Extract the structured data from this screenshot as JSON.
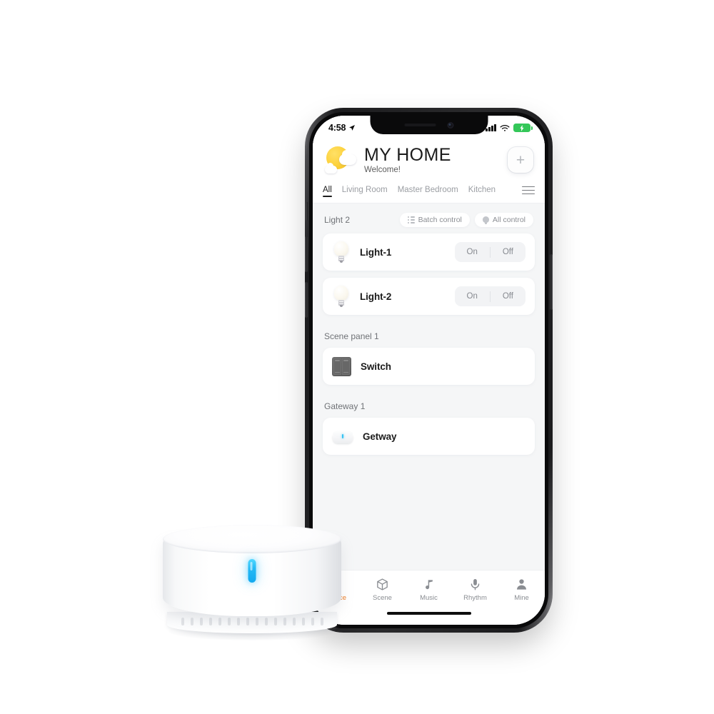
{
  "scene": {
    "background_color": "#ffffff",
    "product_name": "smart-home-hub",
    "product_led_color": "#23b9f5"
  },
  "phone": {
    "frame_color": "#1c1c1e",
    "screen_background": "#f5f6f7"
  },
  "status_bar": {
    "time": "4:58",
    "location_icon": "location-arrow-icon",
    "signal_icon": "cellular-signal-icon",
    "wifi_icon": "wifi-icon",
    "battery_icon": "battery-charging-icon",
    "battery_color": "#34c759"
  },
  "header": {
    "weather_icon": "sun-behind-cloud-icon",
    "title": "MY HOME",
    "subtitle": "Welcome!",
    "add_button_label": "+",
    "add_button_name": "add-device-button"
  },
  "room_tabs": {
    "items": [
      {
        "label": "All",
        "active": true
      },
      {
        "label": "Living Room",
        "active": false
      },
      {
        "label": "Master Bedroom",
        "active": false
      },
      {
        "label": "Kitchen",
        "active": false
      }
    ],
    "menu_icon": "hamburger-menu-icon"
  },
  "groups": [
    {
      "title": "Light 2",
      "actions": [
        {
          "label": "Batch control",
          "icon": "list-icon"
        },
        {
          "label": "All control",
          "icon": "bulb-icon"
        }
      ],
      "devices": [
        {
          "name": "Light-1",
          "icon": "light-bulb-icon",
          "controls": {
            "on": "On",
            "off": "Off"
          }
        },
        {
          "name": "Light-2",
          "icon": "light-bulb-icon",
          "controls": {
            "on": "On",
            "off": "Off"
          }
        }
      ]
    },
    {
      "title": "Scene panel 1",
      "actions": [],
      "devices": [
        {
          "name": "Switch",
          "icon": "wall-switch-icon"
        }
      ]
    },
    {
      "title": "Gateway 1",
      "actions": [],
      "devices": [
        {
          "name": "Getway",
          "icon": "gateway-hub-icon"
        }
      ]
    }
  ],
  "tab_bar": {
    "active_color": "#f07c22",
    "inactive_color": "#8a8d92",
    "items": [
      {
        "label": "Device",
        "icon": "bulb-icon",
        "active": true
      },
      {
        "label": "Scene",
        "icon": "cube-icon",
        "active": false
      },
      {
        "label": "Music",
        "icon": "music-note-icon",
        "active": false
      },
      {
        "label": "Rhythm",
        "icon": "microphone-icon",
        "active": false
      },
      {
        "label": "Mine",
        "icon": "person-icon",
        "active": false
      }
    ]
  }
}
